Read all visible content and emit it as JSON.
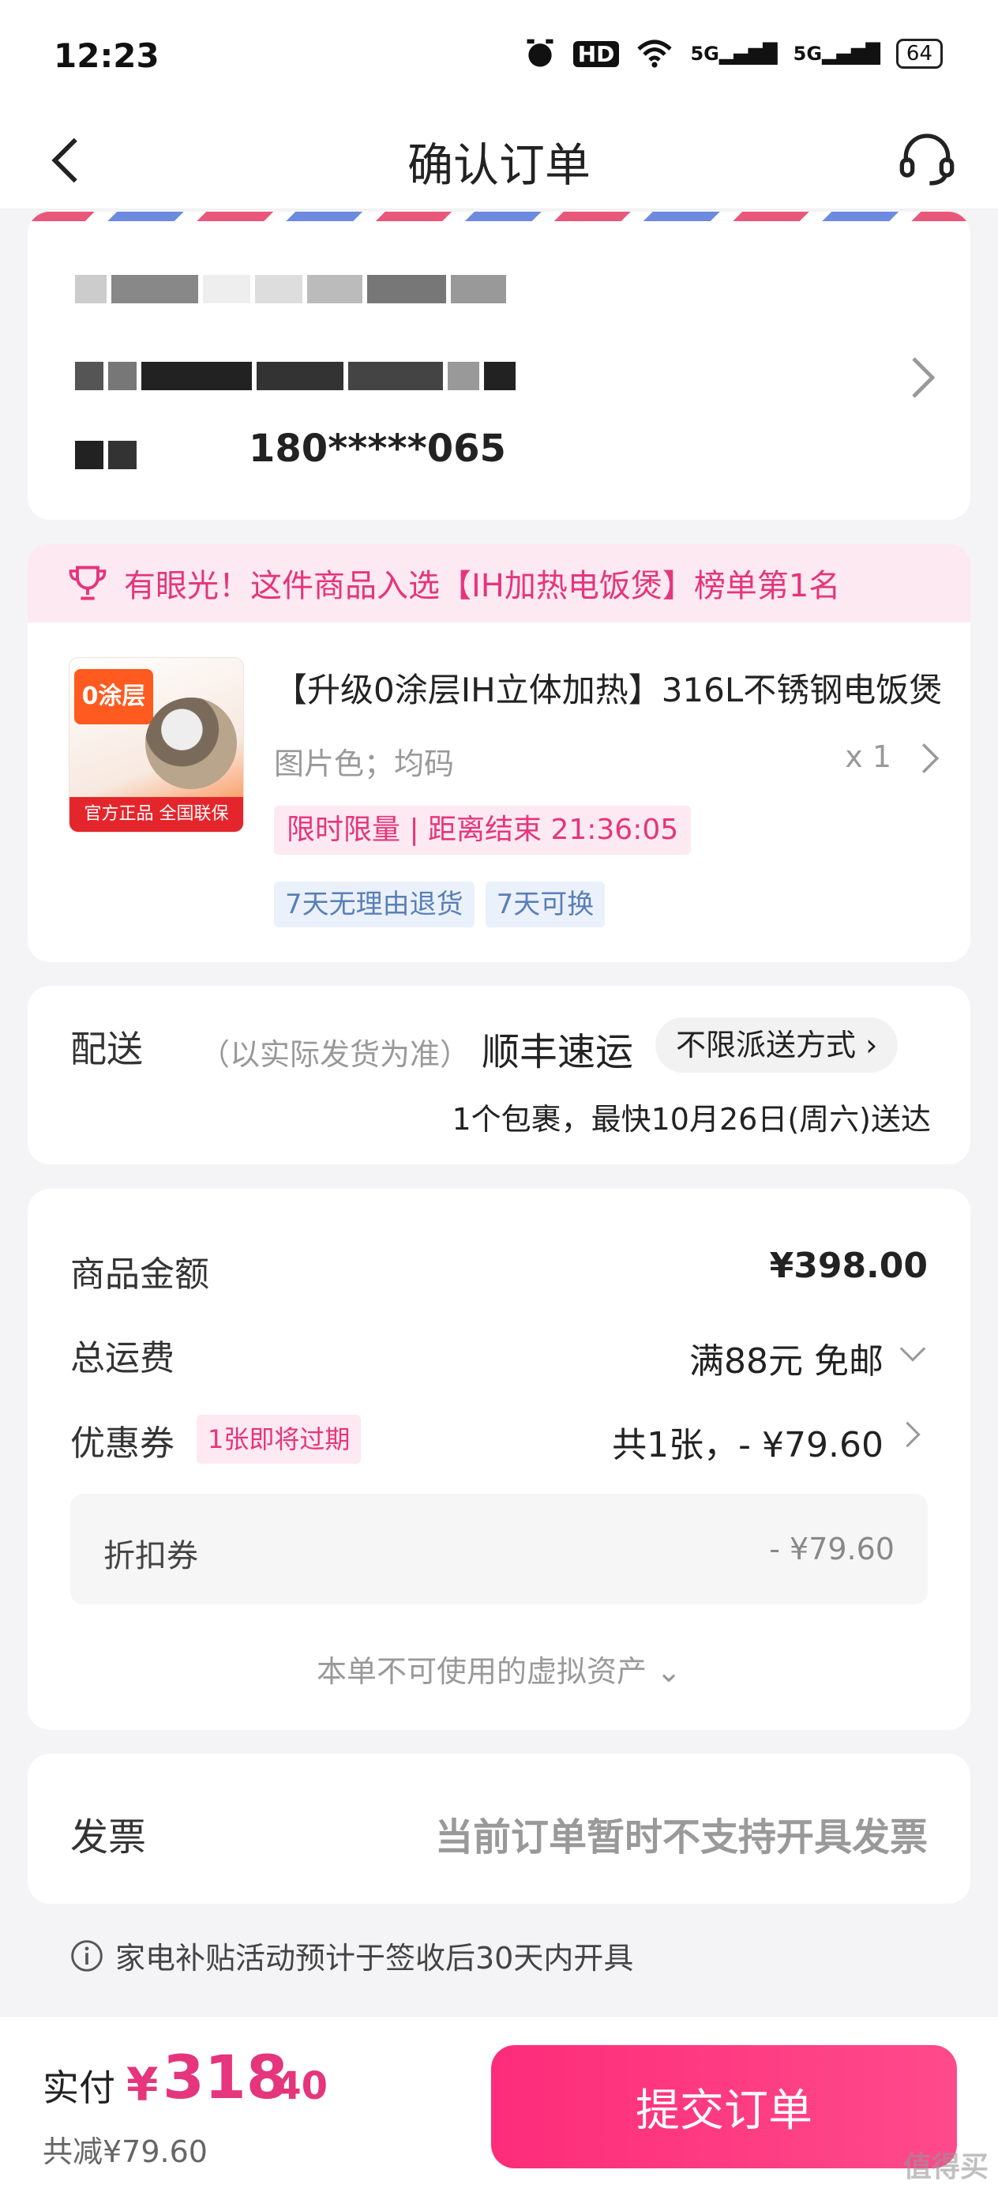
{
  "status_bar": {
    "time": "12:23",
    "network1": "5G",
    "network2": "5G",
    "hd": "HD",
    "battery": "64"
  },
  "header": {
    "title": "确认订单"
  },
  "address": {
    "phone": "180*****065"
  },
  "ranking": {
    "text": "有眼光！这件商品入选【IH加热电饭煲】榜单第1名"
  },
  "product": {
    "title": "【升级0涂层IH立体加热】316L不锈钢电饭煲",
    "spec": "图片色；均码",
    "quantity": "x 1",
    "promo": "限时限量 | 距离结束 21:36:05",
    "tags": [
      "7天无理由退货",
      "7天可换"
    ],
    "image_badge": "0涂层",
    "image_footer": "官方正品 全国联保"
  },
  "delivery": {
    "label": "配送",
    "note": "（以实际发货为准）",
    "carrier": "顺丰速运",
    "method": "不限派送方式",
    "eta": "1个包裹，最快10月26日(周六)送达"
  },
  "price": {
    "goods_label": "商品金额",
    "goods_value": "¥398.00",
    "shipping_label": "总运费",
    "shipping_value": "满88元 免邮",
    "coupon_label": "优惠券",
    "coupon_tag": "1张即将过期",
    "coupon_value": "共1张，- ¥79.60",
    "discount_label": "折扣券",
    "discount_value": "- ¥79.60",
    "virtual_assets": "本单不可使用的虚拟资产"
  },
  "invoice": {
    "label": "发票",
    "value": "当前订单暂时不支持开具发票"
  },
  "notice": "家电补贴活动预计于签收后30天内开具",
  "footer": {
    "pay_label": "实付",
    "pay_symbol": "¥",
    "pay_int": "318",
    "pay_dec": ".40",
    "saved": "共减¥79.60",
    "submit": "提交订单"
  },
  "watermark": "值得买",
  "colors": {
    "accent": "#e5357c",
    "button": "#fd2c7a",
    "tag_blue": "#5a7fb7"
  }
}
